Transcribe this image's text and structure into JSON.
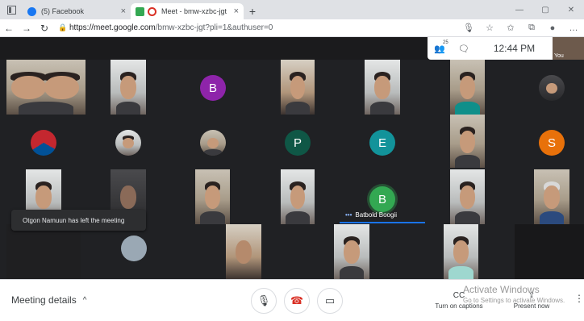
{
  "browser": {
    "tabs": [
      {
        "title": "(5) Facebook",
        "close": "×",
        "favicon_color": "#1877f2"
      },
      {
        "title": "Meet - bmw-xzbc-jgt",
        "close": "×",
        "favicon_color": "#d93025"
      }
    ],
    "new_tab": "+",
    "window_controls": {
      "minimize": "—",
      "restore": "▢",
      "close": "✕"
    },
    "nav": {
      "back": "←",
      "forward": "→",
      "reload": "↻"
    },
    "address": {
      "lock": "🔒",
      "domain": "https://meet.google.com",
      "path": "/bmw-xzbc-jgt?pli=1&authuser=0"
    },
    "toolbar_icons": {
      "mic": "🎙",
      "star_add": "☆",
      "favorites": "✩",
      "collections": "⧉",
      "profile": "●",
      "more": "…"
    }
  },
  "meet": {
    "participants_icon": "👥",
    "participants_count": "25",
    "chat_icon": "🗨",
    "time": "12:44 PM",
    "self_label": "You",
    "avatars": [
      {
        "letter": "B",
        "color": "#8e24aa"
      },
      {
        "letter": "P",
        "color": "#0f5746"
      },
      {
        "letter": "E",
        "color": "#12939a"
      },
      {
        "letter": "S",
        "color": "#e8710a"
      },
      {
        "letter": "B",
        "color": "#33a852"
      }
    ],
    "active_speaker": {
      "dots": "•••",
      "name": "Batbold Boogii"
    },
    "toast": "Otgon Namuun has left the meeting"
  },
  "controls": {
    "details_label": "Meeting details",
    "details_chevron": "^",
    "mic_icon": "🎙",
    "end_call_icon": "☎",
    "camera_icon": "▭",
    "captions": {
      "icon": "CC",
      "label": "Turn on captions"
    },
    "present": {
      "icon": "⇪",
      "label": "Present now"
    },
    "more": "⋮"
  },
  "watermark": {
    "line1": "Activate Windows",
    "line2": "Go to Settings to activate Windows."
  }
}
